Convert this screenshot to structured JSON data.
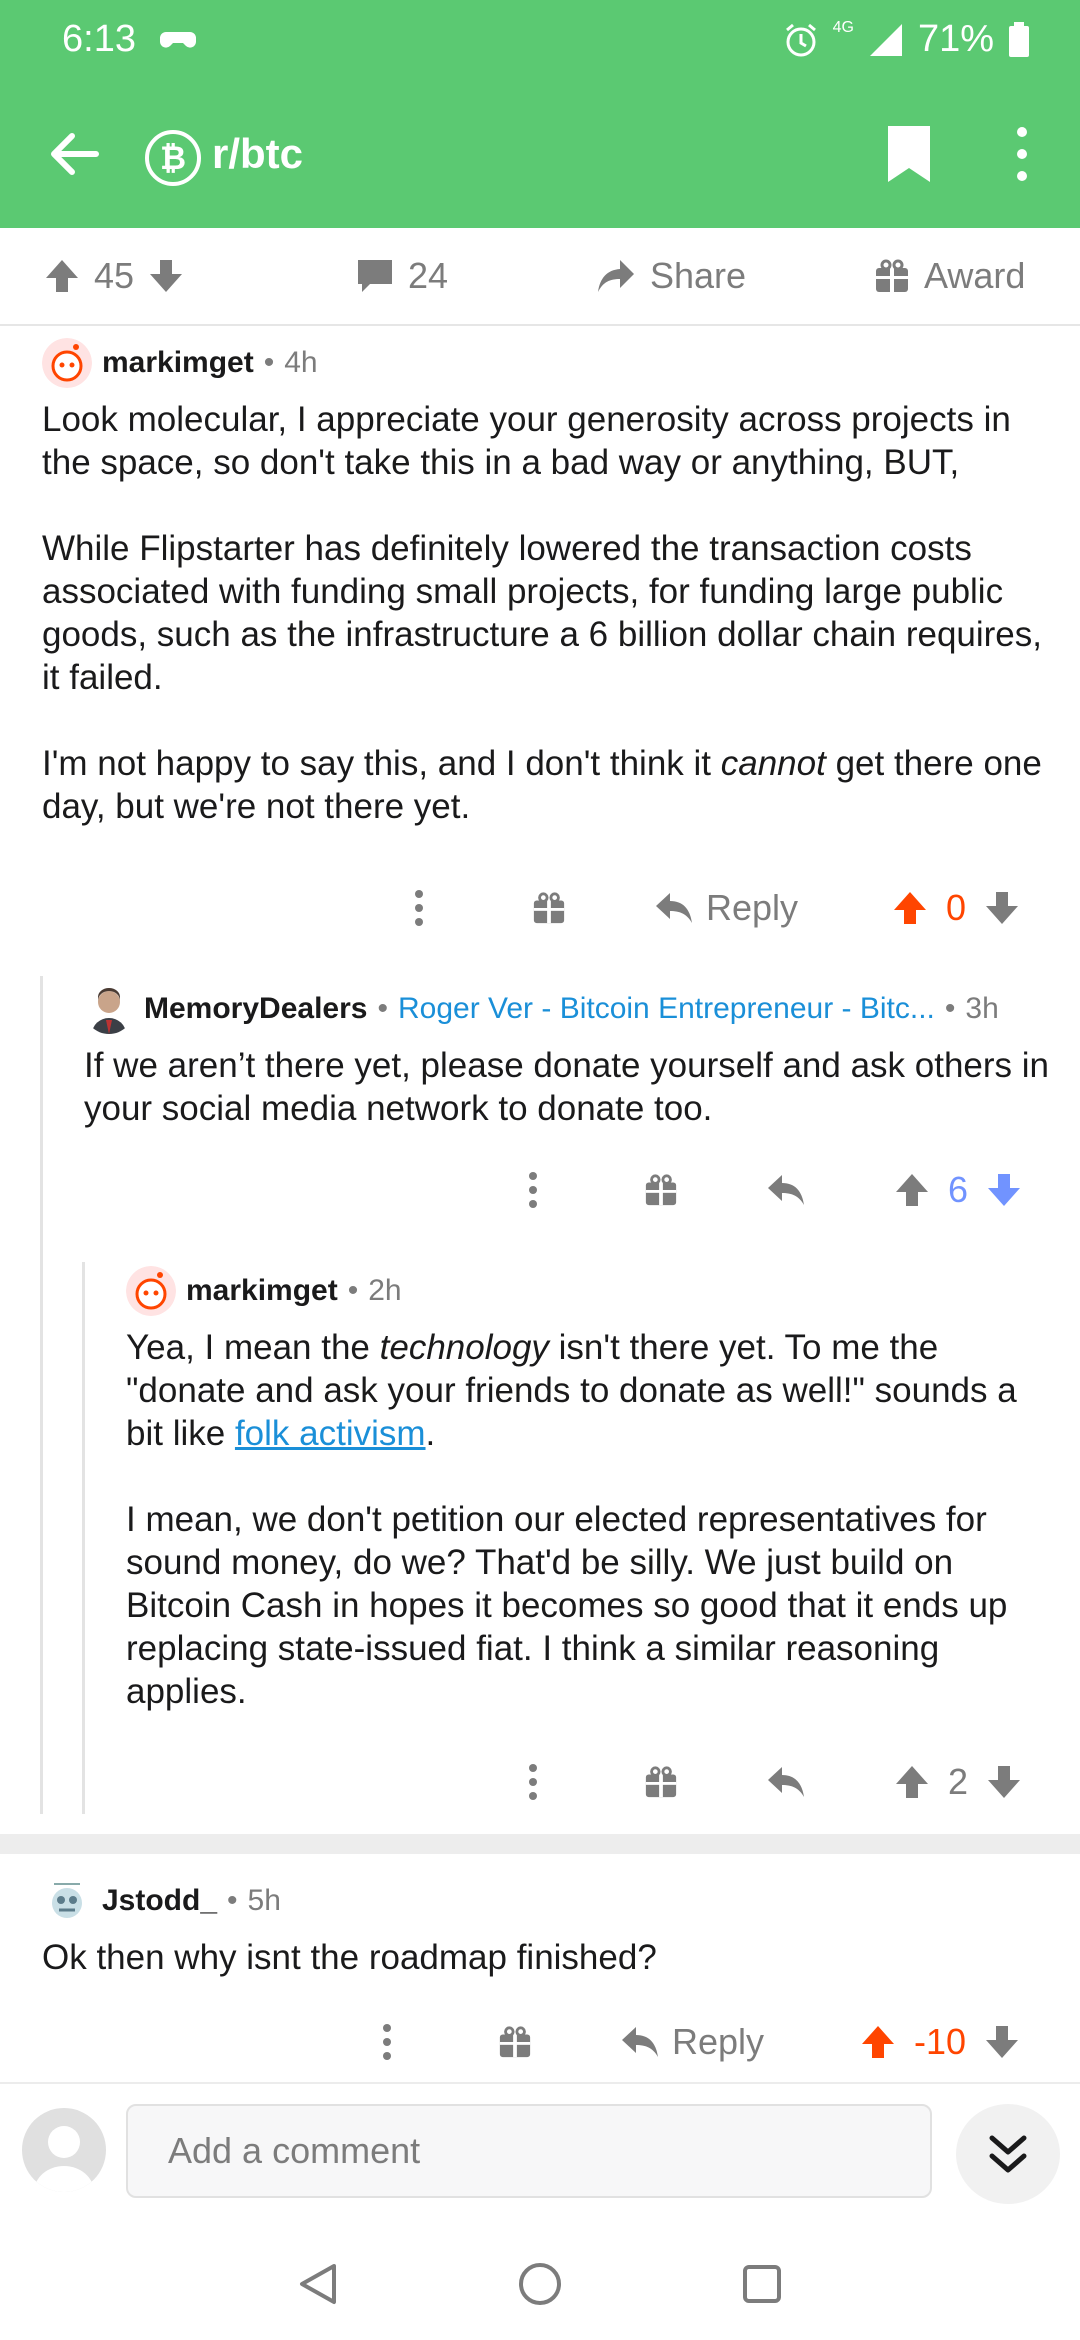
{
  "status_bar": {
    "time": "6:13",
    "battery": "71%",
    "network": "4G"
  },
  "app_bar": {
    "subreddit": "r/btc",
    "logo_glyph": "₿"
  },
  "post_actions": {
    "upvotes": "45",
    "comments": "24",
    "share_label": "Share",
    "award_label": "Award"
  },
  "comments": [
    {
      "user": "markimget",
      "time": "4h",
      "paragraphs": [
        "Look molecular, I appreciate your generosity across projects in the space, so don't take this in a bad way or anything, BUT,",
        "While Flipstarter has definitely lowered the transaction costs associated with funding small projects, for funding large public goods, such as the infrastructure a 6 billion dollar chain requires, it failed."
      ],
      "p3_before": "I'm not happy to say this, and I don't think it ",
      "p3_em": "cannot",
      "p3_after": " get there one day, but we're not there yet.",
      "reply_label": "Reply",
      "score": "0"
    },
    {
      "user": "MemoryDealers",
      "flair": "Roger Ver - Bitcoin Entrepreneur - Bitc...",
      "time": "3h",
      "body": "If we aren’t there yet, please donate yourself and ask others in your social media network to donate too.",
      "score": "6"
    },
    {
      "user": "markimget",
      "time": "2h",
      "p1_before": "Yea, I mean the ",
      "p1_em": "technology",
      "p1_after": " isn't there yet. To me the \"donate and ask your friends to donate as well!\" sounds a bit like ",
      "p1_link": "folk activism",
      "p1_end": ".",
      "p2": "I mean, we don't petition our elected representatives for sound money, do we? That'd be silly. We just build on Bitcoin Cash in hopes it becomes so good that it ends up replacing state-issued fiat. I think a similar reasoning applies.",
      "score": "2"
    },
    {
      "user": "Jstodd_",
      "time": "5h",
      "body": "Ok then why isnt the roadmap finished?",
      "reply_label": "Reply",
      "score": "-10"
    }
  ],
  "composer": {
    "placeholder": "Add a comment"
  },
  "colors": {
    "brand": "#5bc972",
    "upvote": "#ff4500",
    "downvote": "#7193ff",
    "link": "#1a8fd8"
  }
}
